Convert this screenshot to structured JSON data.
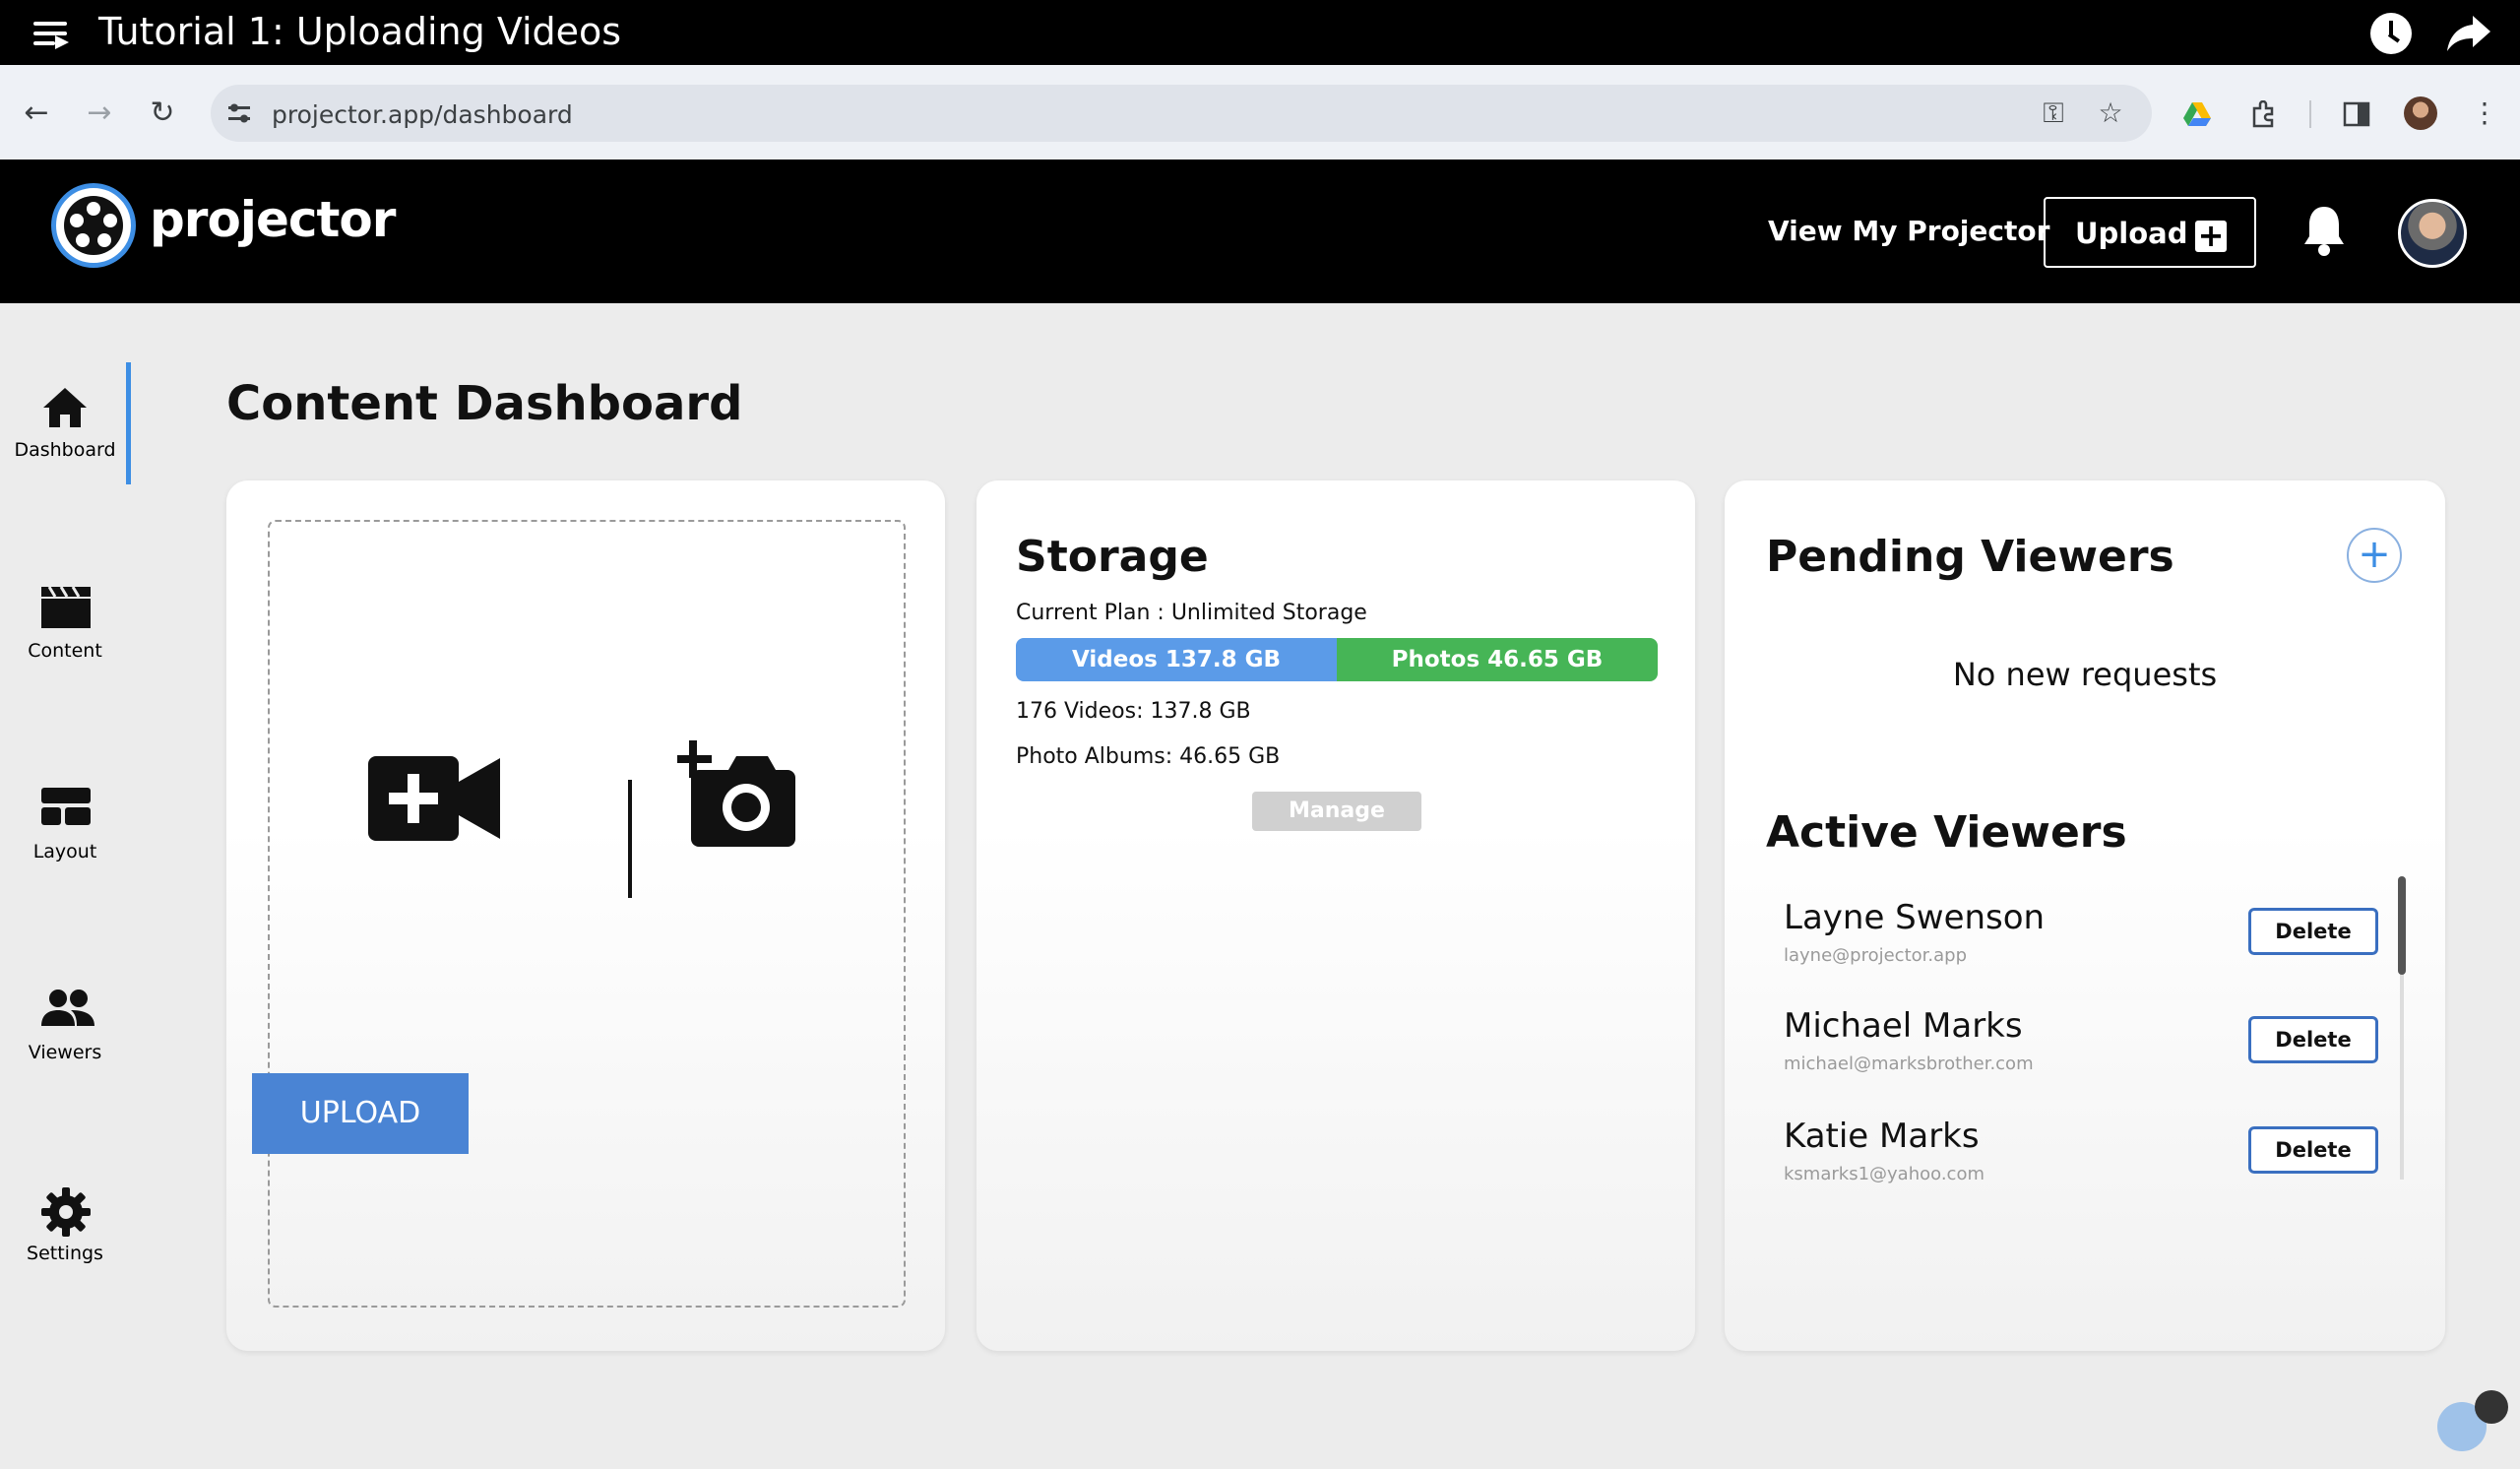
{
  "video": {
    "title": "Tutorial 1: Uploading Videos"
  },
  "browser": {
    "url": "projector.app/dashboard"
  },
  "header": {
    "logo_text": "projector",
    "view_my": "View My Projector",
    "upload_label": "Upload"
  },
  "sidebar": {
    "items": [
      {
        "label": "Dashboard",
        "icon": "home-icon"
      },
      {
        "label": "Content",
        "icon": "clapperboard-icon"
      },
      {
        "label": "Layout",
        "icon": "layout-icon"
      },
      {
        "label": "Viewers",
        "icon": "people-icon"
      },
      {
        "label": "Settings",
        "icon": "gear-icon"
      }
    ],
    "active": "Dashboard"
  },
  "page": {
    "title": "Content Dashboard"
  },
  "upload_card": {
    "button_label": "UPLOAD"
  },
  "storage": {
    "title": "Storage",
    "plan": "Current Plan : Unlimited Storage",
    "videos_bar": "Videos 137.8 GB",
    "photos_bar": "Photos 46.65 GB",
    "videos_fraction": 0.5,
    "videos_line": "176 Videos: 137.8 GB",
    "photos_line": "Photo Albums: 46.65 GB",
    "manage_label": "Manage",
    "colors": {
      "videos": "#5b9be8",
      "photos": "#46b556"
    }
  },
  "viewers": {
    "pending_title": "Pending Viewers",
    "no_requests": "No new requests",
    "active_title": "Active Viewers",
    "delete_label": "Delete",
    "list": [
      {
        "name": "Layne Swenson",
        "email": "layne@projector.app"
      },
      {
        "name": "Michael Marks",
        "email": "michael@marksbrother.com"
      },
      {
        "name": "Katie Marks",
        "email": "ksmarks1@yahoo.com"
      }
    ]
  }
}
